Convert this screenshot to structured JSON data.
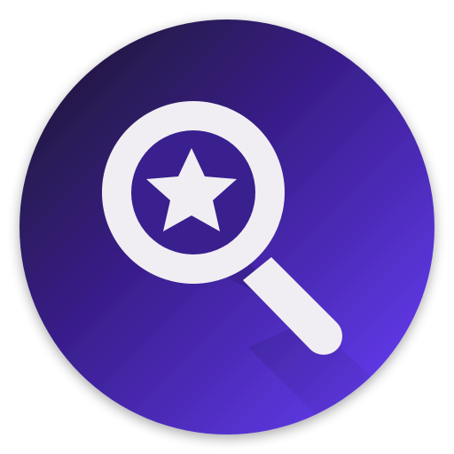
{
  "app_icon": {
    "name": "magnifier-star-icon",
    "colors": {
      "background": "#ffffff",
      "gradient_start": "#1c1628",
      "gradient_mid": "#3a1f8f",
      "gradient_end": "#6a40ff",
      "glyph": "#f0eef2",
      "shadow": "#000000"
    },
    "glyphs": [
      "magnifying-glass-icon",
      "star-icon"
    ]
  }
}
